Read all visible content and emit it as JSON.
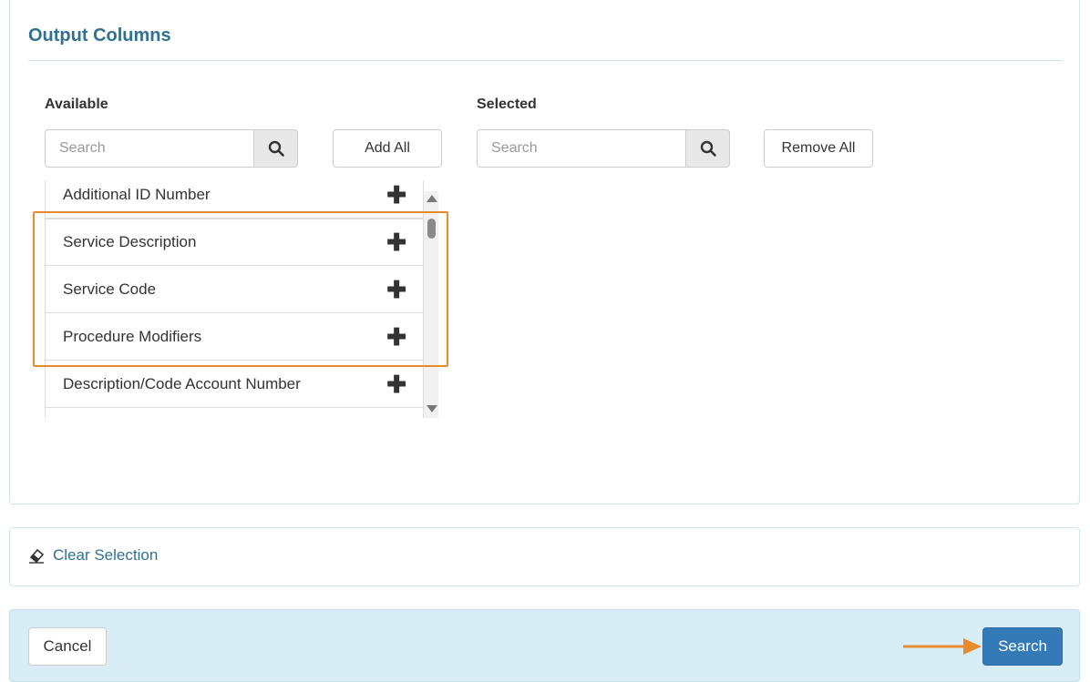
{
  "output_columns": {
    "title": "Output Columns",
    "available": {
      "label": "Available",
      "search_placeholder": "Search",
      "add_all_label": "Add All",
      "items": [
        {
          "label": "Additional ID Number"
        },
        {
          "label": "Service Description"
        },
        {
          "label": "Service Code"
        },
        {
          "label": "Procedure Modifiers"
        },
        {
          "label": "Description/Code Account Number"
        },
        {
          "label": ""
        }
      ],
      "add_icon": "plus-icon"
    },
    "selected": {
      "label": "Selected",
      "search_placeholder": "Search",
      "remove_all_label": "Remove All"
    }
  },
  "clear": {
    "label": "Clear Selection",
    "icon": "eraser-icon"
  },
  "footer": {
    "cancel_label": "Cancel",
    "search_label": "Search"
  },
  "colors": {
    "accent": "#337ab7",
    "title": "#31708f",
    "highlight": "#e88a2e",
    "footer_bg": "#d9edf7"
  }
}
